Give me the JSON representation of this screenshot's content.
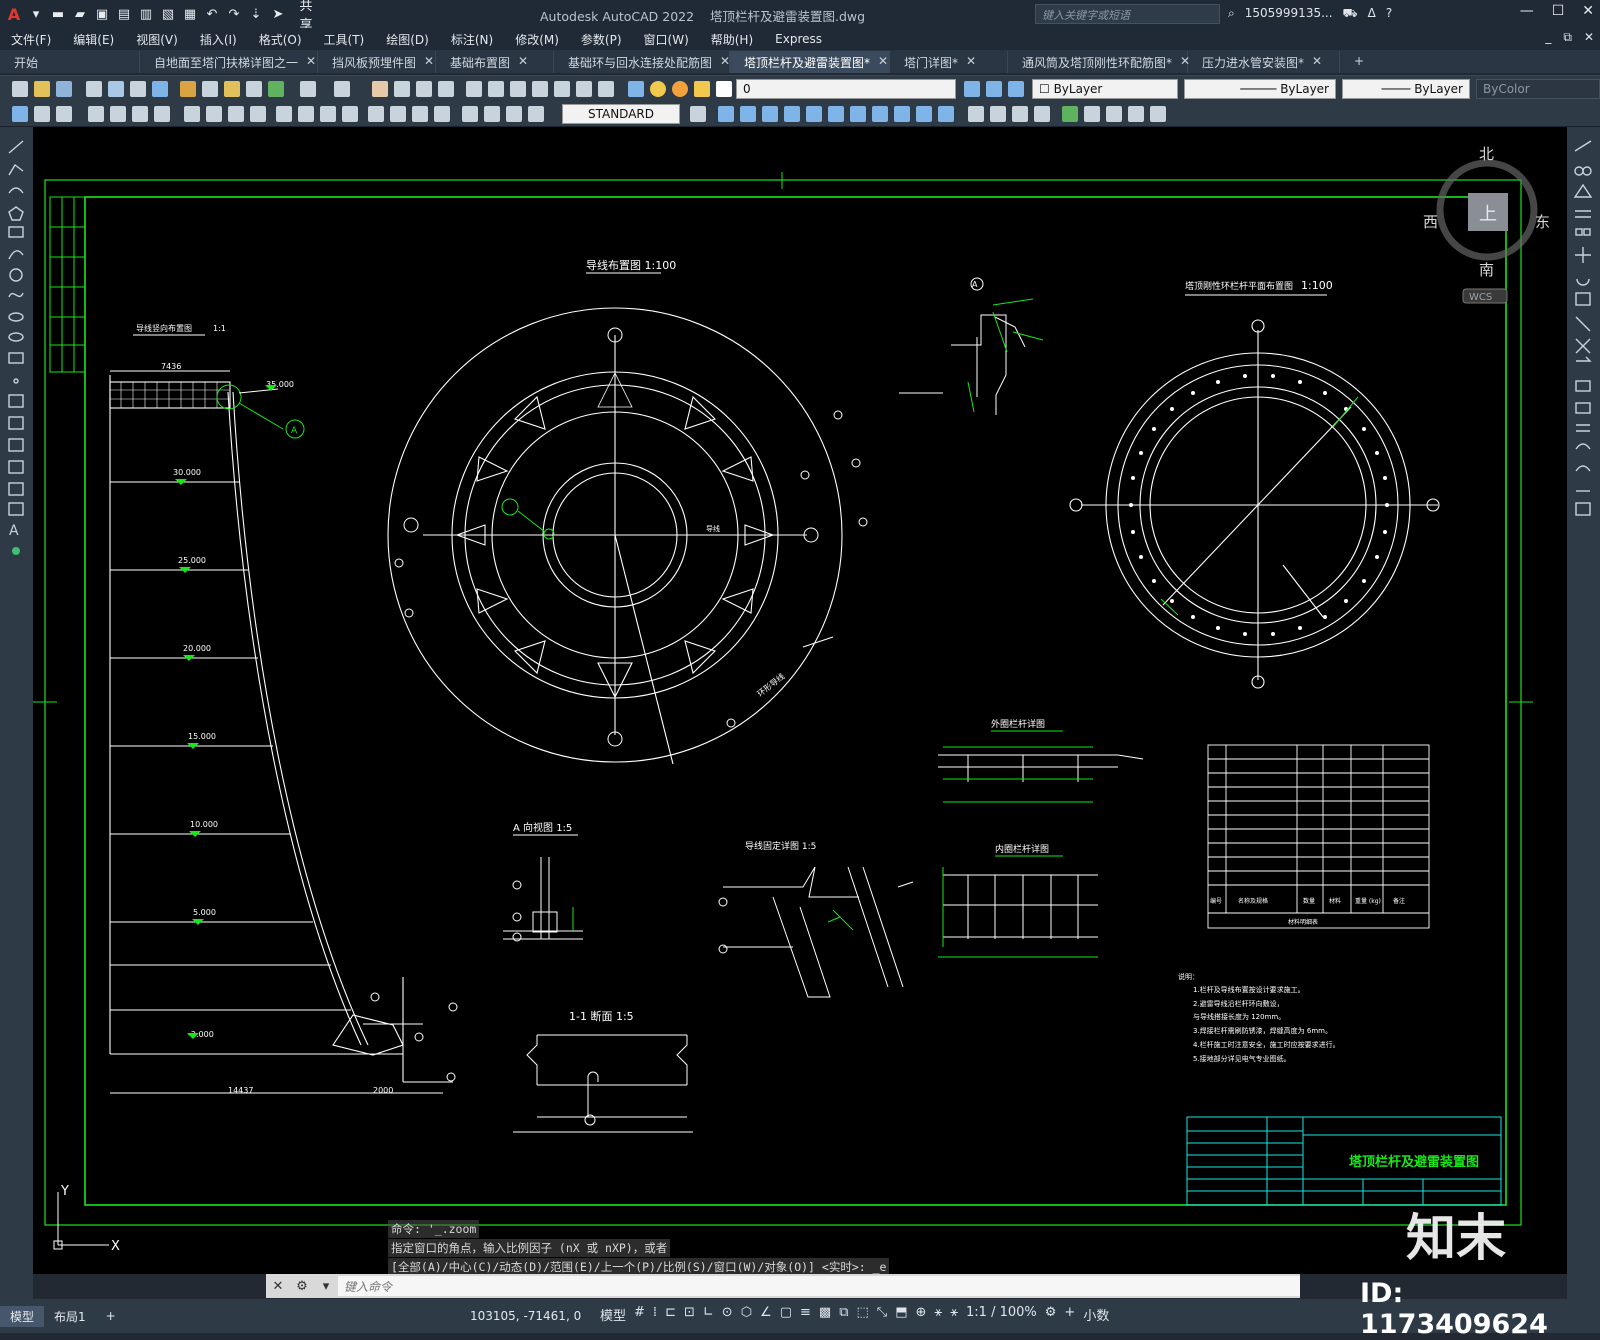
{
  "app": {
    "title": "Autodesk AutoCAD 2022",
    "file": "塔顶栏杆及避雷装置图.dwg",
    "share_label": "共享",
    "search_placeholder": "键入关键字或短语",
    "user": "1505999135...",
    "logo_letter": "A"
  },
  "menu": [
    "文件(F)",
    "编辑(E)",
    "视图(V)",
    "插入(I)",
    "格式(O)",
    "工具(T)",
    "绘图(D)",
    "标注(N)",
    "修改(M)",
    "参数(P)",
    "窗口(W)",
    "帮助(H)",
    "Express"
  ],
  "tabs": [
    {
      "label": "开始",
      "active": false
    },
    {
      "label": "自地面至塔门扶梯详图之一",
      "active": false
    },
    {
      "label": "挡风板预埋件图",
      "active": false
    },
    {
      "label": "基础布置图",
      "active": false
    },
    {
      "label": "基础环与回水连接处配筋图",
      "active": false
    },
    {
      "label": "塔顶栏杆及避雷装置图*",
      "active": true
    },
    {
      "label": "塔门详图*",
      "active": false
    },
    {
      "label": "通风筒及塔顶刚性环配筋图*",
      "active": false
    },
    {
      "label": "压力进水管安装图*",
      "active": false
    }
  ],
  "properties": {
    "layer": "0",
    "color": "ByLayer",
    "linetype": "ByLayer",
    "lineweight": "ByLayer",
    "plotstyle": "ByColor",
    "textstyle": "STANDARD"
  },
  "viewcube": {
    "north": "北",
    "south": "南",
    "east": "东",
    "west": "西",
    "face": "上",
    "ucs": "WCS"
  },
  "drawing": {
    "elev_title": "导线竖向布置图",
    "elev_scale": "1:1",
    "plan_title": "导线布置图 1:100",
    "ring_title": "塔顶刚性环栏杆平面布置图",
    "ring_scale": "1:100",
    "outer_rail": "外圈栏杆详图",
    "inner_rail": "内圈栏杆详图",
    "view_a": "A 向视图 1:5",
    "wire_fix": "导线固定详图 1:5",
    "section": "1-1 断面 1:5",
    "dim_top": "7436",
    "dim_bottom": "14437",
    "dim_right": "2000",
    "elevations": [
      "35.000",
      "30.000",
      "25.000",
      "20.000",
      "15.000",
      "10.000",
      "5.000",
      "-2.000"
    ],
    "notes_title": "说明：",
    "notes": [
      "1.栏杆及导线布置按设计要求施工。",
      "2.避雷导线沿栏杆环向敷设，",
      "   与导线搭接长度为 120mm。",
      "3.焊接栏杆需刷防锈漆，焊缝高度为 6mm。",
      "4.栏杆施工时注意安全，施工时应按要求进行。",
      "5.接地部分详见电气专业图纸。"
    ],
    "title_block": "塔顶栏杆及避雷装置图",
    "ring_label": "环形导线",
    "wire_label": "导线",
    "table_footer": "材料明细表",
    "table_header": [
      "编号",
      "名称及规格",
      "数量",
      "材料",
      "重量 (kg)",
      "备注"
    ]
  },
  "command": {
    "history": [
      "命令: '_.zoom",
      "指定窗口的角点，输入比例因子 (nX 或 nXP)，或者",
      "[全部(A)/中心(C)/动态(D)/范围(E)/上一个(P)/比例(S)/窗口(W)/对象(O)] <实时>: _e"
    ],
    "placeholder": "键入命令"
  },
  "status": {
    "layout_tabs": [
      "模型",
      "布局1"
    ],
    "coords": "103105, -71461, 0",
    "model": "模型",
    "scale": "1:1 / 100%",
    "units": "小数"
  },
  "watermark": {
    "brand": "知末",
    "id": "ID: 1173409624"
  }
}
